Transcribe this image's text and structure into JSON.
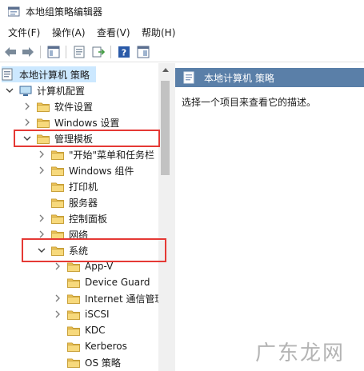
{
  "window": {
    "title": "本地组策略编辑器"
  },
  "menu": [
    "文件(F)",
    "操作(A)",
    "查看(V)",
    "帮助(H)"
  ],
  "toolbar": {
    "buttons": [
      "back-icon",
      "forward-icon",
      "show-hide-tree-icon",
      "properties-icon",
      "export-list-icon",
      "help-icon",
      "show-pane-icon"
    ]
  },
  "tree": [
    {
      "label": "本地计算机 策略",
      "level": 0,
      "expander": "none",
      "selected": true
    },
    {
      "label": "计算机配置",
      "level": 0,
      "expander": "expanded"
    },
    {
      "label": "软件设置",
      "level": 1,
      "expander": "collapsed"
    },
    {
      "label": "Windows 设置",
      "level": 1,
      "expander": "collapsed"
    },
    {
      "label": "管理模板",
      "level": 1,
      "expander": "expanded"
    },
    {
      "label": "\"开始\"菜单和任务栏",
      "level": 2,
      "expander": "collapsed"
    },
    {
      "label": "Windows 组件",
      "level": 2,
      "expander": "collapsed"
    },
    {
      "label": "打印机",
      "level": 2,
      "expander": "none"
    },
    {
      "label": "服务器",
      "level": 2,
      "expander": "none"
    },
    {
      "label": "控制面板",
      "level": 2,
      "expander": "collapsed"
    },
    {
      "label": "网络",
      "level": 2,
      "expander": "collapsed"
    },
    {
      "label": "系统",
      "level": 2,
      "expander": "expanded"
    },
    {
      "label": "App-V",
      "level": 3,
      "expander": "collapsed"
    },
    {
      "label": "Device Guard",
      "level": 3,
      "expander": "none"
    },
    {
      "label": "Internet 通信管理",
      "level": 3,
      "expander": "collapsed"
    },
    {
      "label": "iSCSI",
      "level": 3,
      "expander": "collapsed"
    },
    {
      "label": "KDC",
      "level": 3,
      "expander": "none"
    },
    {
      "label": "Kerberos",
      "level": 3,
      "expander": "none"
    },
    {
      "label": "OS 策略",
      "level": 3,
      "expander": "none"
    }
  ],
  "right_pane": {
    "header": "本地计算机 策略",
    "description": "选择一个项目来查看它的描述。"
  },
  "watermark": "广东龙网",
  "colors": {
    "header_bg": "#5a7fa8",
    "selection_bg": "#cce8ff",
    "highlight_red": "#e53935",
    "folder_yellow": "#f2c75c"
  }
}
